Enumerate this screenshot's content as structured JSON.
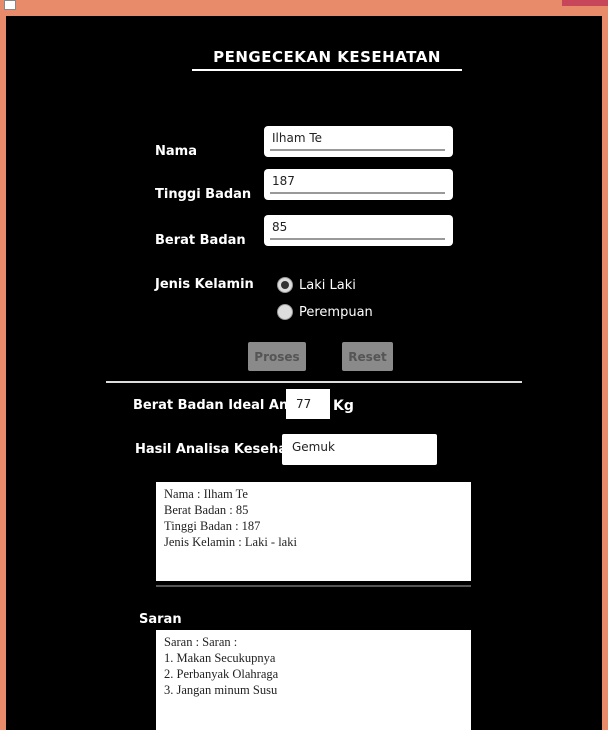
{
  "window": {
    "title": ""
  },
  "header": {
    "title": "PENGECEKAN KESEHATAN"
  },
  "form": {
    "nama_label": "Nama",
    "nama_value": "Ilham Te",
    "tinggi_label": "Tinggi Badan",
    "tinggi_value": "187",
    "berat_label": "Berat Badan",
    "berat_value": "85",
    "gender_label": "Jenis Kelamin",
    "gender_options": [
      "Laki Laki",
      "Perempuan"
    ],
    "gender_selected": "Laki Laki"
  },
  "buttons": {
    "proses": "Proses",
    "reset": "Reset"
  },
  "result": {
    "ideal_label": "Berat Badan Ideal Anda",
    "ideal_value": "77",
    "ideal_unit": "Kg",
    "analisa_label": "Hasil Analisa Kesehatan",
    "analisa_value": "Gemuk"
  },
  "summary_lines": [
    "Nama : Ilham Te",
    "Berat Badan : 85",
    "Tinggi Badan : 187",
    "Jenis Kelamin : Laki - laki"
  ],
  "saran": {
    "label": "Saran",
    "lines": [
      "Saran : Saran :",
      "1. Makan Secukupnya",
      "2. Perbanyak Olahraga",
      "3. Jangan minum Susu"
    ]
  },
  "colors": {
    "frame": "#E88B6B",
    "background": "#000000",
    "close": "#C7465A",
    "button": "#8A8A8A"
  }
}
